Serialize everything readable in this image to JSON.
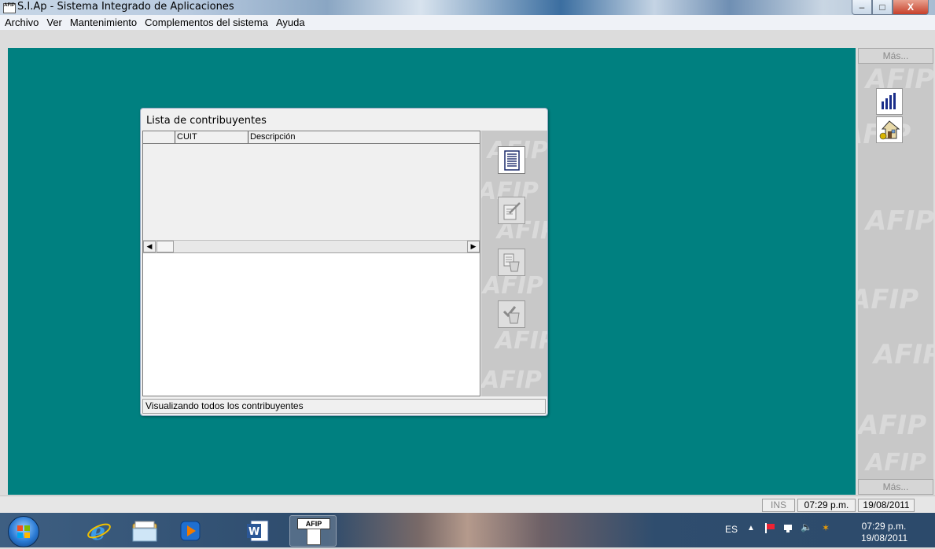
{
  "window": {
    "title": "S.I.Ap - Sistema Integrado de Aplicaciones",
    "app_icon_text": "AFIP",
    "controls": {
      "minimize": "–",
      "maximize": "□",
      "close": "X"
    }
  },
  "menu": [
    "Archivo",
    "Ver",
    "Mantenimiento",
    "Complementos del sistema",
    "Ayuda"
  ],
  "right_panel": {
    "top_label": "Más...",
    "bottom_label": "Más...",
    "watermark": "AFIP",
    "icons": [
      "bar-chart-icon",
      "house-money-icon"
    ]
  },
  "dialog": {
    "title": "Lista de contribuyentes",
    "columns": [
      "",
      "CUIT",
      "Descripción"
    ],
    "rows": [],
    "status": "Visualizando todos los contribuyentes",
    "tool_icons": [
      "list-document-icon",
      "edit-pencil-icon",
      "delete-trash-icon",
      "check-trash-icon"
    ]
  },
  "status_bar": {
    "mode": "INS",
    "time": "07:29 p.m.",
    "date": "19/08/2011"
  },
  "taskbar": {
    "apps": [
      "start-orb",
      "internet-explorer-icon",
      "file-explorer-icon",
      "media-player-icon",
      "word-icon",
      "afip-icon"
    ],
    "app_label": "AFIP",
    "tray_lang": "ES",
    "tray_time": "07:29 p.m.",
    "tray_date": "19/08/2011"
  },
  "colors": {
    "desktop": "#008080",
    "panel": "#c8c8c8",
    "dialog_bg": "#f0f0f0"
  }
}
